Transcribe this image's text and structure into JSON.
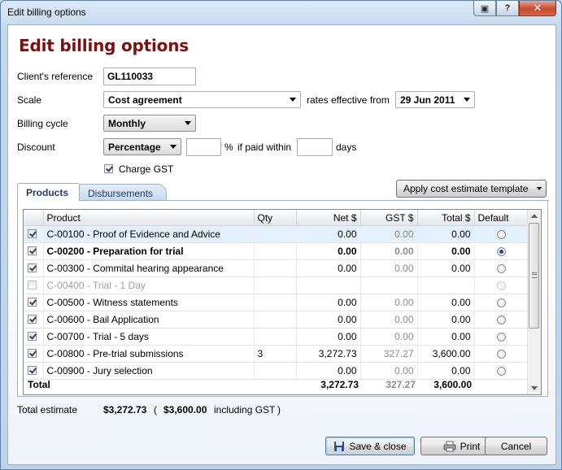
{
  "window": {
    "title": "Edit billing options",
    "buttons": {
      "restore": "▣",
      "help": "?",
      "close": "✕"
    }
  },
  "heading": "Edit billing options",
  "form": {
    "client_ref_label": "Client's reference",
    "client_ref_value": "GL110033",
    "scale_label": "Scale",
    "scale_value": "Cost agreement",
    "rates_label": "rates effective from",
    "rates_date": "29 Jun 2011",
    "billing_cycle_label": "Billing cycle",
    "billing_cycle_value": "Monthly",
    "discount_label": "Discount",
    "discount_type": "Percentage",
    "discount_value": "",
    "percent_sign": "%",
    "paid_within_label": "if paid within",
    "paid_within_value": "",
    "days_label": "days",
    "charge_gst_label": "Charge GST",
    "charge_gst_checked": true
  },
  "tabs": [
    {
      "label": "Products",
      "active": true
    },
    {
      "label": "Disbursements",
      "active": false
    }
  ],
  "apply_template_label": "Apply cost estimate template",
  "grid": {
    "columns": [
      "",
      "Product",
      "Qty",
      "Net $",
      "GST $",
      "Total $",
      "Default"
    ],
    "rows": [
      {
        "checked": true,
        "product": "C-00100 - Proof of Evidence and Advice",
        "qty": "",
        "net": "0.00",
        "gst": "0.00",
        "total": "0.00",
        "default": false,
        "style": "selected"
      },
      {
        "checked": true,
        "product": "C-00200 - Preparation for trial",
        "qty": "",
        "net": "0.00",
        "gst": "0.00",
        "total": "0.00",
        "default": true,
        "style": "bold"
      },
      {
        "checked": true,
        "product": "C-00300 - Commital hearing appearance",
        "qty": "",
        "net": "0.00",
        "gst": "0.00",
        "total": "0.00",
        "default": false,
        "style": ""
      },
      {
        "checked": false,
        "product": "C-00400 - Trial - 1 Day",
        "qty": "",
        "net": "",
        "gst": "",
        "total": "",
        "default": false,
        "style": "disabled"
      },
      {
        "checked": true,
        "product": "C-00500 - Witness statements",
        "qty": "",
        "net": "0.00",
        "gst": "0.00",
        "total": "0.00",
        "default": false,
        "style": ""
      },
      {
        "checked": true,
        "product": "C-00600 - Bail Application",
        "qty": "",
        "net": "0.00",
        "gst": "0.00",
        "total": "0.00",
        "default": false,
        "style": ""
      },
      {
        "checked": true,
        "product": "C-00700 - Trial - 5 days",
        "qty": "",
        "net": "0.00",
        "gst": "0.00",
        "total": "0.00",
        "default": false,
        "style": ""
      },
      {
        "checked": true,
        "product": "C-00800 - Pre-trial submissions",
        "qty": "3",
        "net": "3,272.73",
        "gst": "327.27",
        "total": "3,600.00",
        "default": false,
        "style": ""
      },
      {
        "checked": true,
        "product": "C-00900 - Jury selection",
        "qty": "",
        "net": "0.00",
        "gst": "0.00",
        "total": "0.00",
        "default": false,
        "style": ""
      }
    ],
    "totals": {
      "label": "Total",
      "net": "3,272.73",
      "gst": "327.27",
      "total": "3,600.00"
    }
  },
  "summary": {
    "label": "Total estimate",
    "amount": "$3,272.73",
    "paren_open": "(",
    "incl_amount": "$3,600.00",
    "incl_label": "including GST",
    "paren_close": ")"
  },
  "footer": {
    "save_label": "Save & close",
    "print_label": "Print",
    "cancel_label": "Cancel"
  }
}
